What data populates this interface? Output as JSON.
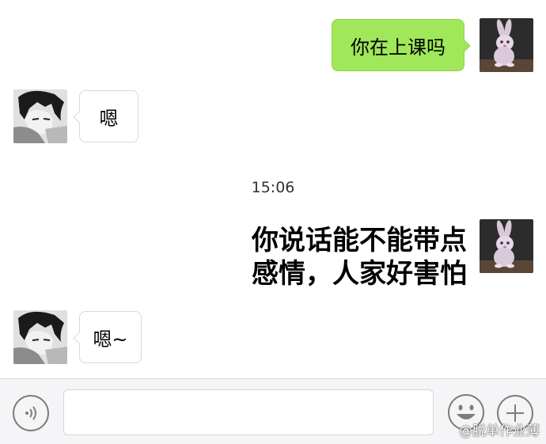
{
  "messages": [
    {
      "sender": "me",
      "avatar_icon": "bunny-avatar-icon",
      "text": "你在上课吗"
    },
    {
      "sender": "other",
      "avatar_icon": "anime-boy-avatar-icon",
      "text": "嗯"
    },
    {
      "timestamp": "15:06"
    },
    {
      "sender": "me",
      "avatar_icon": "bunny-avatar-icon",
      "style": "bold-large-text",
      "lines": [
        "你说话能不能带点",
        "感情，人家好害怕"
      ]
    },
    {
      "sender": "other",
      "avatar_icon": "anime-boy-avatar-icon",
      "text": "嗯~"
    }
  ],
  "input_bar": {
    "voice_icon": "voice-wave-icon",
    "input_value": "",
    "emoji_icon": "smiley-icon",
    "plus_icon": "plus-circle-icon"
  },
  "watermark": "@脱单作业薄",
  "colors": {
    "outgoing_bubble": "#a0e75a",
    "incoming_bubble": "#ffffff",
    "input_bar_bg": "#f5f5f7"
  }
}
